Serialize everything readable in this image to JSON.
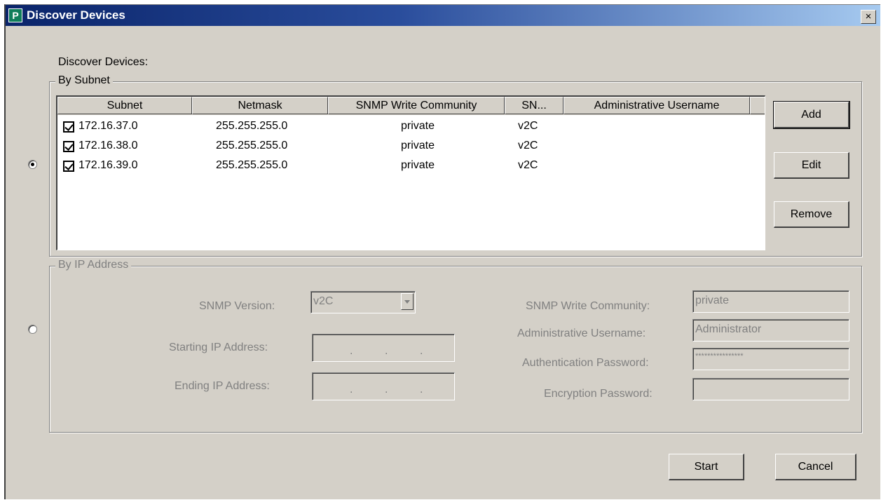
{
  "window": {
    "title": "Discover Devices",
    "close_glyph": "×",
    "icon": "app-icon"
  },
  "heading": "Discover Devices:",
  "by_subnet": {
    "title": "By Subnet",
    "columns": [
      "Subnet",
      "Netmask",
      "SNMP Write Community",
      "SN...",
      "Administrative Username",
      ""
    ],
    "rows": [
      {
        "checked": true,
        "subnet": "172.16.37.0",
        "netmask": "255.255.255.0",
        "community": "private",
        "snmp": "v2C",
        "admin": ""
      },
      {
        "checked": true,
        "subnet": "172.16.38.0",
        "netmask": "255.255.255.0",
        "community": "private",
        "snmp": "v2C",
        "admin": ""
      },
      {
        "checked": true,
        "subnet": "172.16.39.0",
        "netmask": "255.255.255.0",
        "community": "private",
        "snmp": "v2C",
        "admin": ""
      }
    ],
    "buttons": {
      "add": "Add",
      "edit": "Edit",
      "remove": "Remove"
    },
    "selected": true
  },
  "by_ip": {
    "title": "By IP Address",
    "selected": false,
    "snmp_version_label": "SNMP Version:",
    "snmp_version_value": "v2C",
    "start_ip_label": "Starting IP Address:",
    "end_ip_label": "Ending IP Address:",
    "ip_separator": ".",
    "community_label": "SNMP Write Community:",
    "community_value": "private",
    "admin_user_label": "Administrative Username:",
    "admin_user_value": "Administrator",
    "auth_pw_label": "Authentication Password:",
    "auth_pw_value": "****************",
    "enc_pw_label": "Encryption Password:",
    "enc_pw_value": ""
  },
  "footer": {
    "start": "Start",
    "cancel": "Cancel"
  }
}
